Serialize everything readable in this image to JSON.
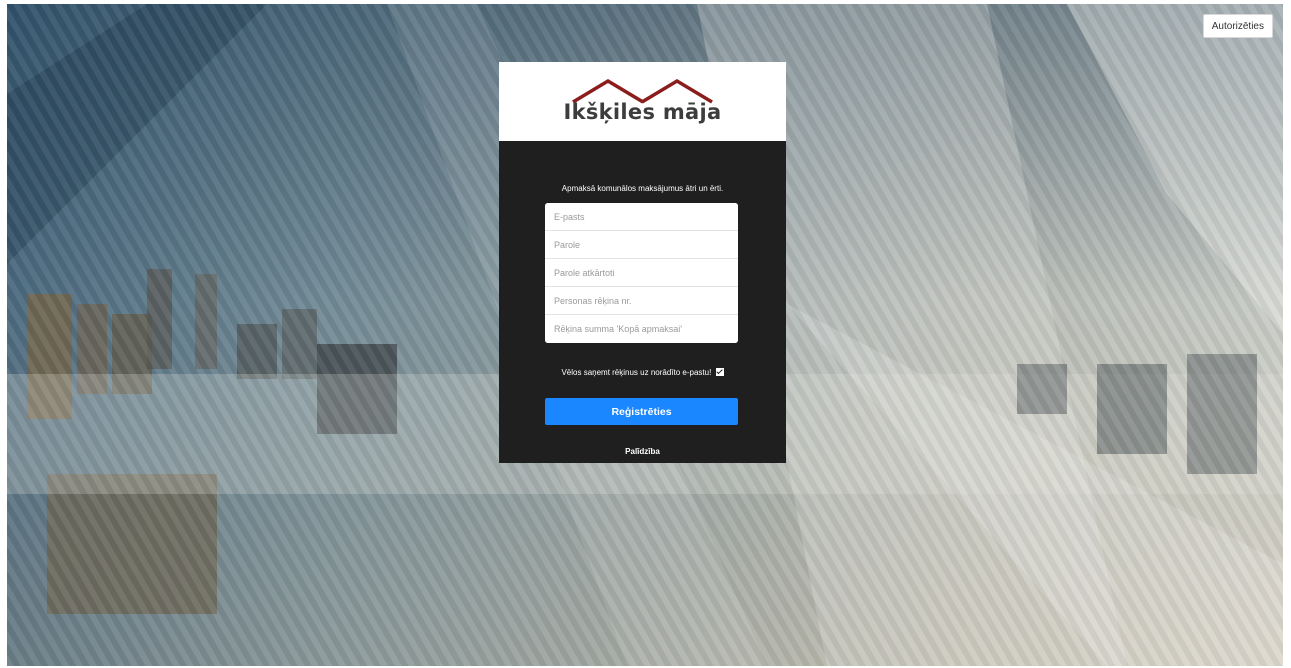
{
  "header": {
    "login_label": "Autorizēties"
  },
  "brand": {
    "logo_text": "Ikšķiles māja",
    "roof_color": "#8b1d1d"
  },
  "form": {
    "tagline": "Apmaksā komunālos maksājumus ātri un ērti.",
    "fields": [
      {
        "placeholder": "E-pasts"
      },
      {
        "placeholder": "Parole"
      },
      {
        "placeholder": "Parole atkārtoti"
      },
      {
        "placeholder": "Personas rēķina nr."
      },
      {
        "placeholder": "Rēķina summa 'Kopā apmaksai'"
      }
    ],
    "email_invoice_label": "Vēlos saņemt rēķinus uz norādīto e-pastu!",
    "email_invoice_checked": true,
    "submit_label": "Reģistrēties",
    "help_label": "Palīdzība"
  },
  "colors": {
    "accent": "#1a86ff",
    "panel": "#1f1f1f"
  }
}
